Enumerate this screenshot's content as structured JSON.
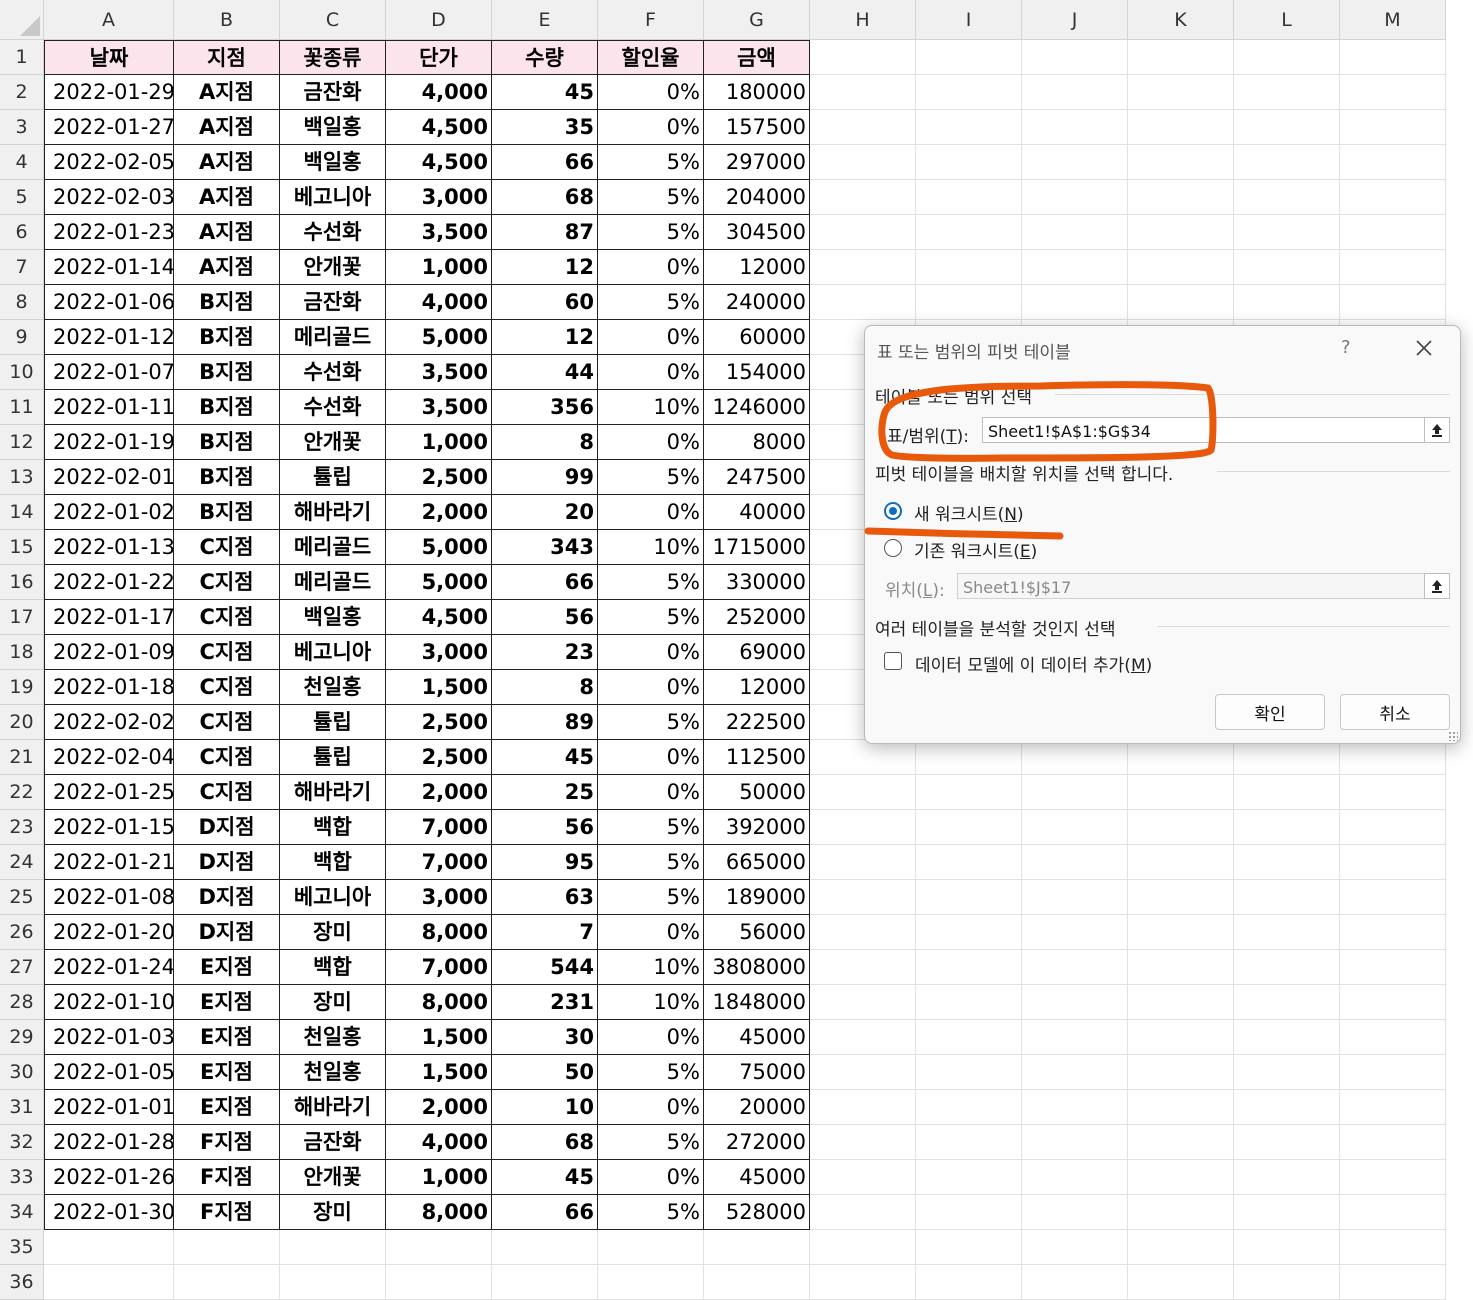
{
  "columns": [
    "A",
    "B",
    "C",
    "D",
    "E",
    "F",
    "G",
    "H",
    "I",
    "J",
    "K",
    "L",
    "M"
  ],
  "rows": [
    "1",
    "2",
    "3",
    "4",
    "5",
    "6",
    "7",
    "8",
    "9",
    "10",
    "11",
    "12",
    "13",
    "14",
    "15",
    "16",
    "17",
    "18",
    "19",
    "20",
    "21",
    "22",
    "23",
    "24",
    "25",
    "26",
    "27",
    "28",
    "29",
    "30",
    "31",
    "32",
    "33",
    "34",
    "35",
    "36"
  ],
  "table": {
    "headers": [
      "날짜",
      "지점",
      "꽃종류",
      "단가",
      "수량",
      "할인율",
      "금액"
    ],
    "rows": [
      [
        "2022-01-29",
        "A지점",
        "금잔화",
        "4,000",
        "45",
        "0%",
        "180000"
      ],
      [
        "2022-01-27",
        "A지점",
        "백일홍",
        "4,500",
        "35",
        "0%",
        "157500"
      ],
      [
        "2022-02-05",
        "A지점",
        "백일홍",
        "4,500",
        "66",
        "5%",
        "297000"
      ],
      [
        "2022-02-03",
        "A지점",
        "베고니아",
        "3,000",
        "68",
        "5%",
        "204000"
      ],
      [
        "2022-01-23",
        "A지점",
        "수선화",
        "3,500",
        "87",
        "5%",
        "304500"
      ],
      [
        "2022-01-14",
        "A지점",
        "안개꽃",
        "1,000",
        "12",
        "0%",
        "12000"
      ],
      [
        "2022-01-06",
        "B지점",
        "금잔화",
        "4,000",
        "60",
        "5%",
        "240000"
      ],
      [
        "2022-01-12",
        "B지점",
        "메리골드",
        "5,000",
        "12",
        "0%",
        "60000"
      ],
      [
        "2022-01-07",
        "B지점",
        "수선화",
        "3,500",
        "44",
        "0%",
        "154000"
      ],
      [
        "2022-01-11",
        "B지점",
        "수선화",
        "3,500",
        "356",
        "10%",
        "1246000"
      ],
      [
        "2022-01-19",
        "B지점",
        "안개꽃",
        "1,000",
        "8",
        "0%",
        "8000"
      ],
      [
        "2022-02-01",
        "B지점",
        "튤립",
        "2,500",
        "99",
        "5%",
        "247500"
      ],
      [
        "2022-01-02",
        "B지점",
        "해바라기",
        "2,000",
        "20",
        "0%",
        "40000"
      ],
      [
        "2022-01-13",
        "C지점",
        "메리골드",
        "5,000",
        "343",
        "10%",
        "1715000"
      ],
      [
        "2022-01-22",
        "C지점",
        "메리골드",
        "5,000",
        "66",
        "5%",
        "330000"
      ],
      [
        "2022-01-17",
        "C지점",
        "백일홍",
        "4,500",
        "56",
        "5%",
        "252000"
      ],
      [
        "2022-01-09",
        "C지점",
        "베고니아",
        "3,000",
        "23",
        "0%",
        "69000"
      ],
      [
        "2022-01-18",
        "C지점",
        "천일홍",
        "1,500",
        "8",
        "0%",
        "12000"
      ],
      [
        "2022-02-02",
        "C지점",
        "튤립",
        "2,500",
        "89",
        "5%",
        "222500"
      ],
      [
        "2022-02-04",
        "C지점",
        "튤립",
        "2,500",
        "45",
        "0%",
        "112500"
      ],
      [
        "2022-01-25",
        "C지점",
        "해바라기",
        "2,000",
        "25",
        "0%",
        "50000"
      ],
      [
        "2022-01-15",
        "D지점",
        "백합",
        "7,000",
        "56",
        "5%",
        "392000"
      ],
      [
        "2022-01-21",
        "D지점",
        "백합",
        "7,000",
        "95",
        "5%",
        "665000"
      ],
      [
        "2022-01-08",
        "D지점",
        "베고니아",
        "3,000",
        "63",
        "5%",
        "189000"
      ],
      [
        "2022-01-20",
        "D지점",
        "장미",
        "8,000",
        "7",
        "0%",
        "56000"
      ],
      [
        "2022-01-24",
        "E지점",
        "백합",
        "7,000",
        "544",
        "10%",
        "3808000"
      ],
      [
        "2022-01-10",
        "E지점",
        "장미",
        "8,000",
        "231",
        "10%",
        "1848000"
      ],
      [
        "2022-01-03",
        "E지점",
        "천일홍",
        "1,500",
        "30",
        "0%",
        "45000"
      ],
      [
        "2022-01-05",
        "E지점",
        "천일홍",
        "1,500",
        "50",
        "5%",
        "75000"
      ],
      [
        "2022-01-01",
        "E지점",
        "해바라기",
        "2,000",
        "10",
        "0%",
        "20000"
      ],
      [
        "2022-01-28",
        "F지점",
        "금잔화",
        "4,000",
        "68",
        "5%",
        "272000"
      ],
      [
        "2022-01-26",
        "F지점",
        "안개꽃",
        "1,000",
        "45",
        "0%",
        "45000"
      ],
      [
        "2022-01-30",
        "F지점",
        "장미",
        "8,000",
        "66",
        "5%",
        "528000"
      ]
    ]
  },
  "dialog": {
    "title": "표 또는 범위의 피벗 테이블",
    "help": "?",
    "section_select": "테이블 또는 범위 선택",
    "range_label_main": "표/범위(",
    "range_label_key": "T",
    "range_label_end": "):",
    "range_value": "Sheet1!$A$1:$G$34",
    "section_location": "피벗 테이블을 배치할 위치를 선택 합니다.",
    "radio_new_main": "새 워크시트(",
    "radio_new_key": "N",
    "radio_new_end": ")",
    "radio_existing_main": "기존 워크시트(",
    "radio_existing_key": "E",
    "radio_existing_end": ")",
    "location_label_main": "위치(",
    "location_label_key": "L",
    "location_label_end": "):",
    "location_value": "Sheet1!$J$17",
    "section_multi": "여러 테이블을 분석할 것인지 선택",
    "checkbox_main": "데이터 모델에 이 데이터 추가(",
    "checkbox_key": "M",
    "checkbox_end": ")",
    "ok_label": "확인",
    "cancel_label": "취소",
    "selected_option": "new_worksheet",
    "add_to_data_model": false
  },
  "annotation_color": "#e8590c",
  "accent_color": "#0f6cbd"
}
